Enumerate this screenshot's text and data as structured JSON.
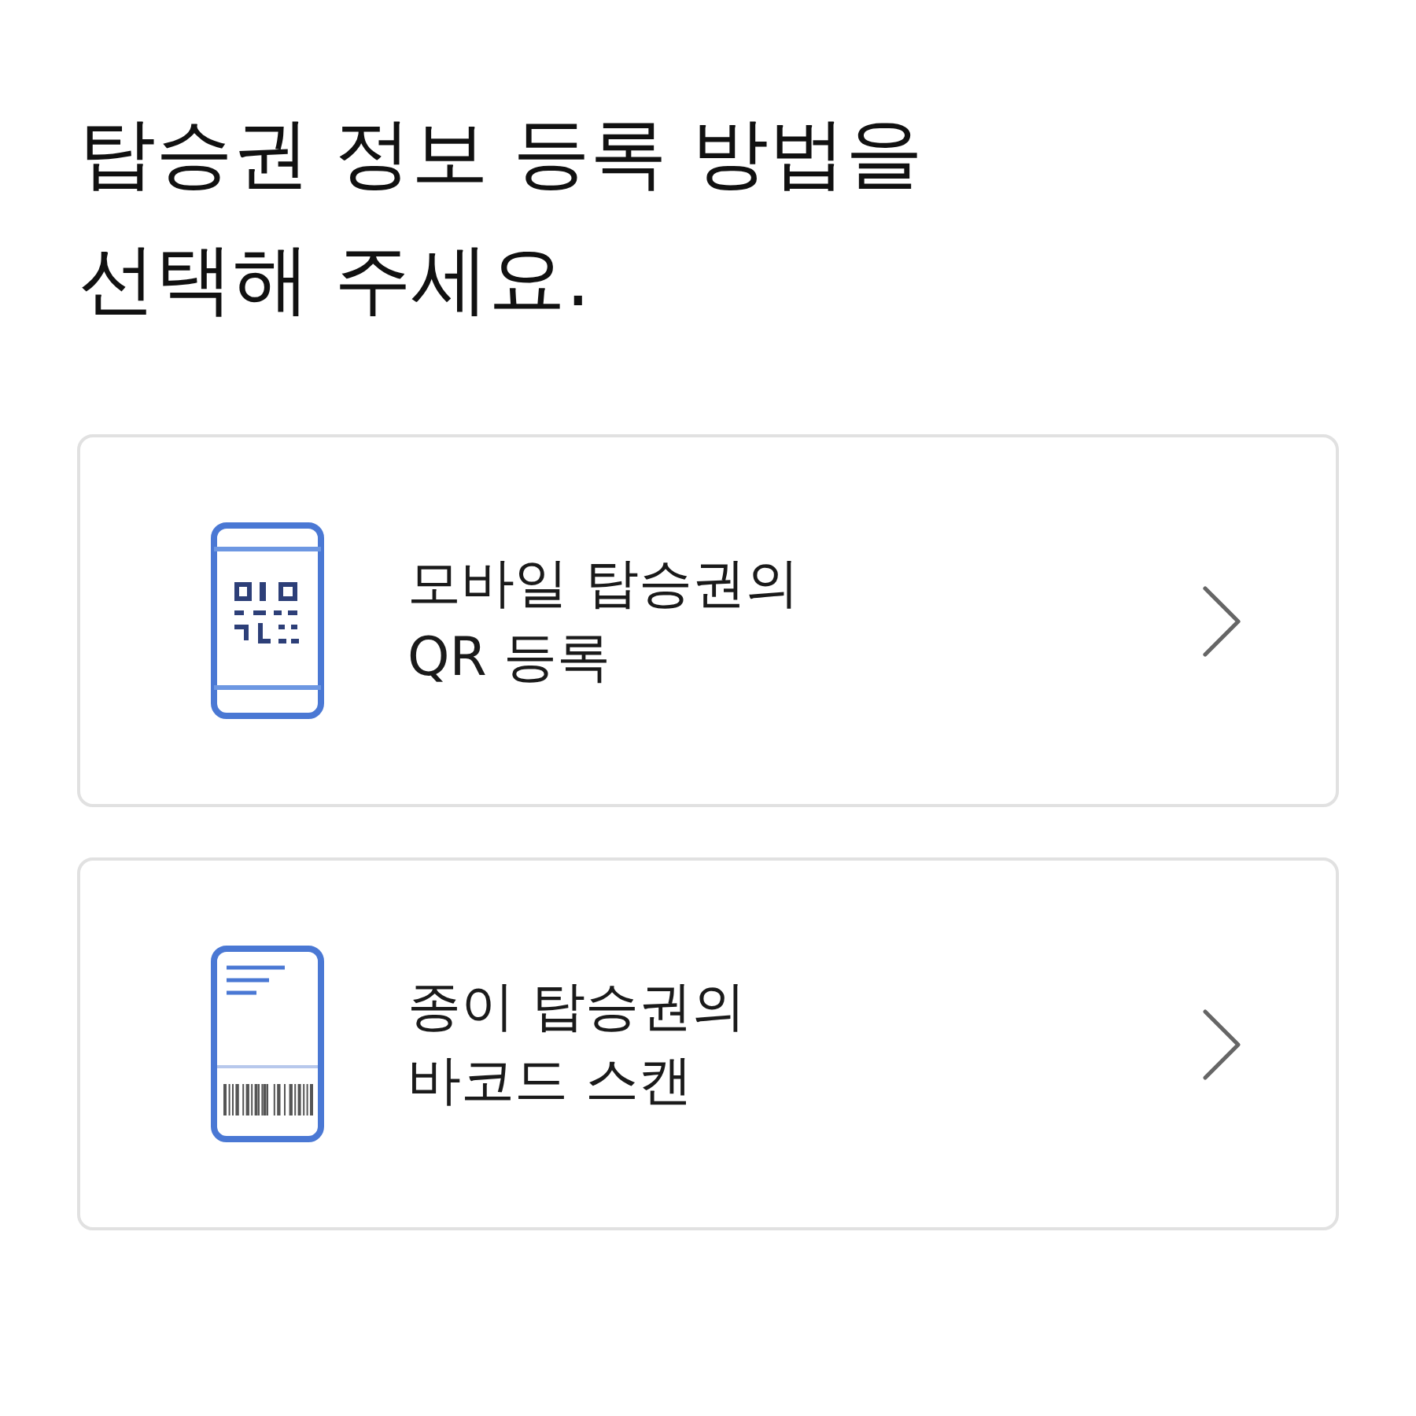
{
  "title": "탑승권 정보 등록 방법을\n선택해 주세요.",
  "options": [
    {
      "kind": "qr",
      "label": "모바일 탑승권의\nQR 등록"
    },
    {
      "kind": "barcode",
      "label": "종이 탑승권의\n바코드 스캔"
    }
  ]
}
